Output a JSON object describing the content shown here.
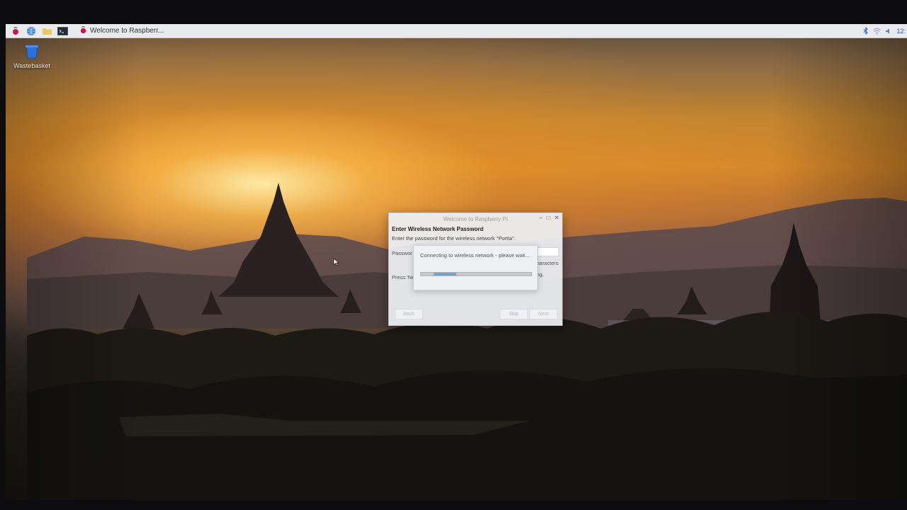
{
  "taskbar": {
    "launchers": [
      "raspberry-menu-icon",
      "web-browser-icon",
      "file-manager-icon",
      "terminal-icon"
    ],
    "window_title": "Welcome to Raspberr...",
    "tray": {
      "icons": [
        "bluetooth-icon",
        "wifi-icon",
        "volume-icon"
      ],
      "clock": "12:"
    }
  },
  "desktop": {
    "icons": [
      {
        "label": "Wastebasket",
        "icon": "wastebasket-icon"
      }
    ]
  },
  "dialog": {
    "title": "Welcome to Raspberry Pi",
    "heading": "Enter Wireless Network Password",
    "description": "Enter the password for the wireless network \"Portia\".",
    "password_label": "Passwor",
    "hint_right": "haracters",
    "press_text": "Press 'Ne",
    "press_right": "ng.",
    "buttons": {
      "back": "Back",
      "skip": "Skip",
      "next": "Next"
    }
  },
  "progress_popup": {
    "message": "Connecting to wireless network - please wait...",
    "progress": 0.3
  },
  "colors": {
    "taskbar": "#e9eaee",
    "accent": "#2255aa",
    "progress_fill": "#7d9ec4"
  }
}
